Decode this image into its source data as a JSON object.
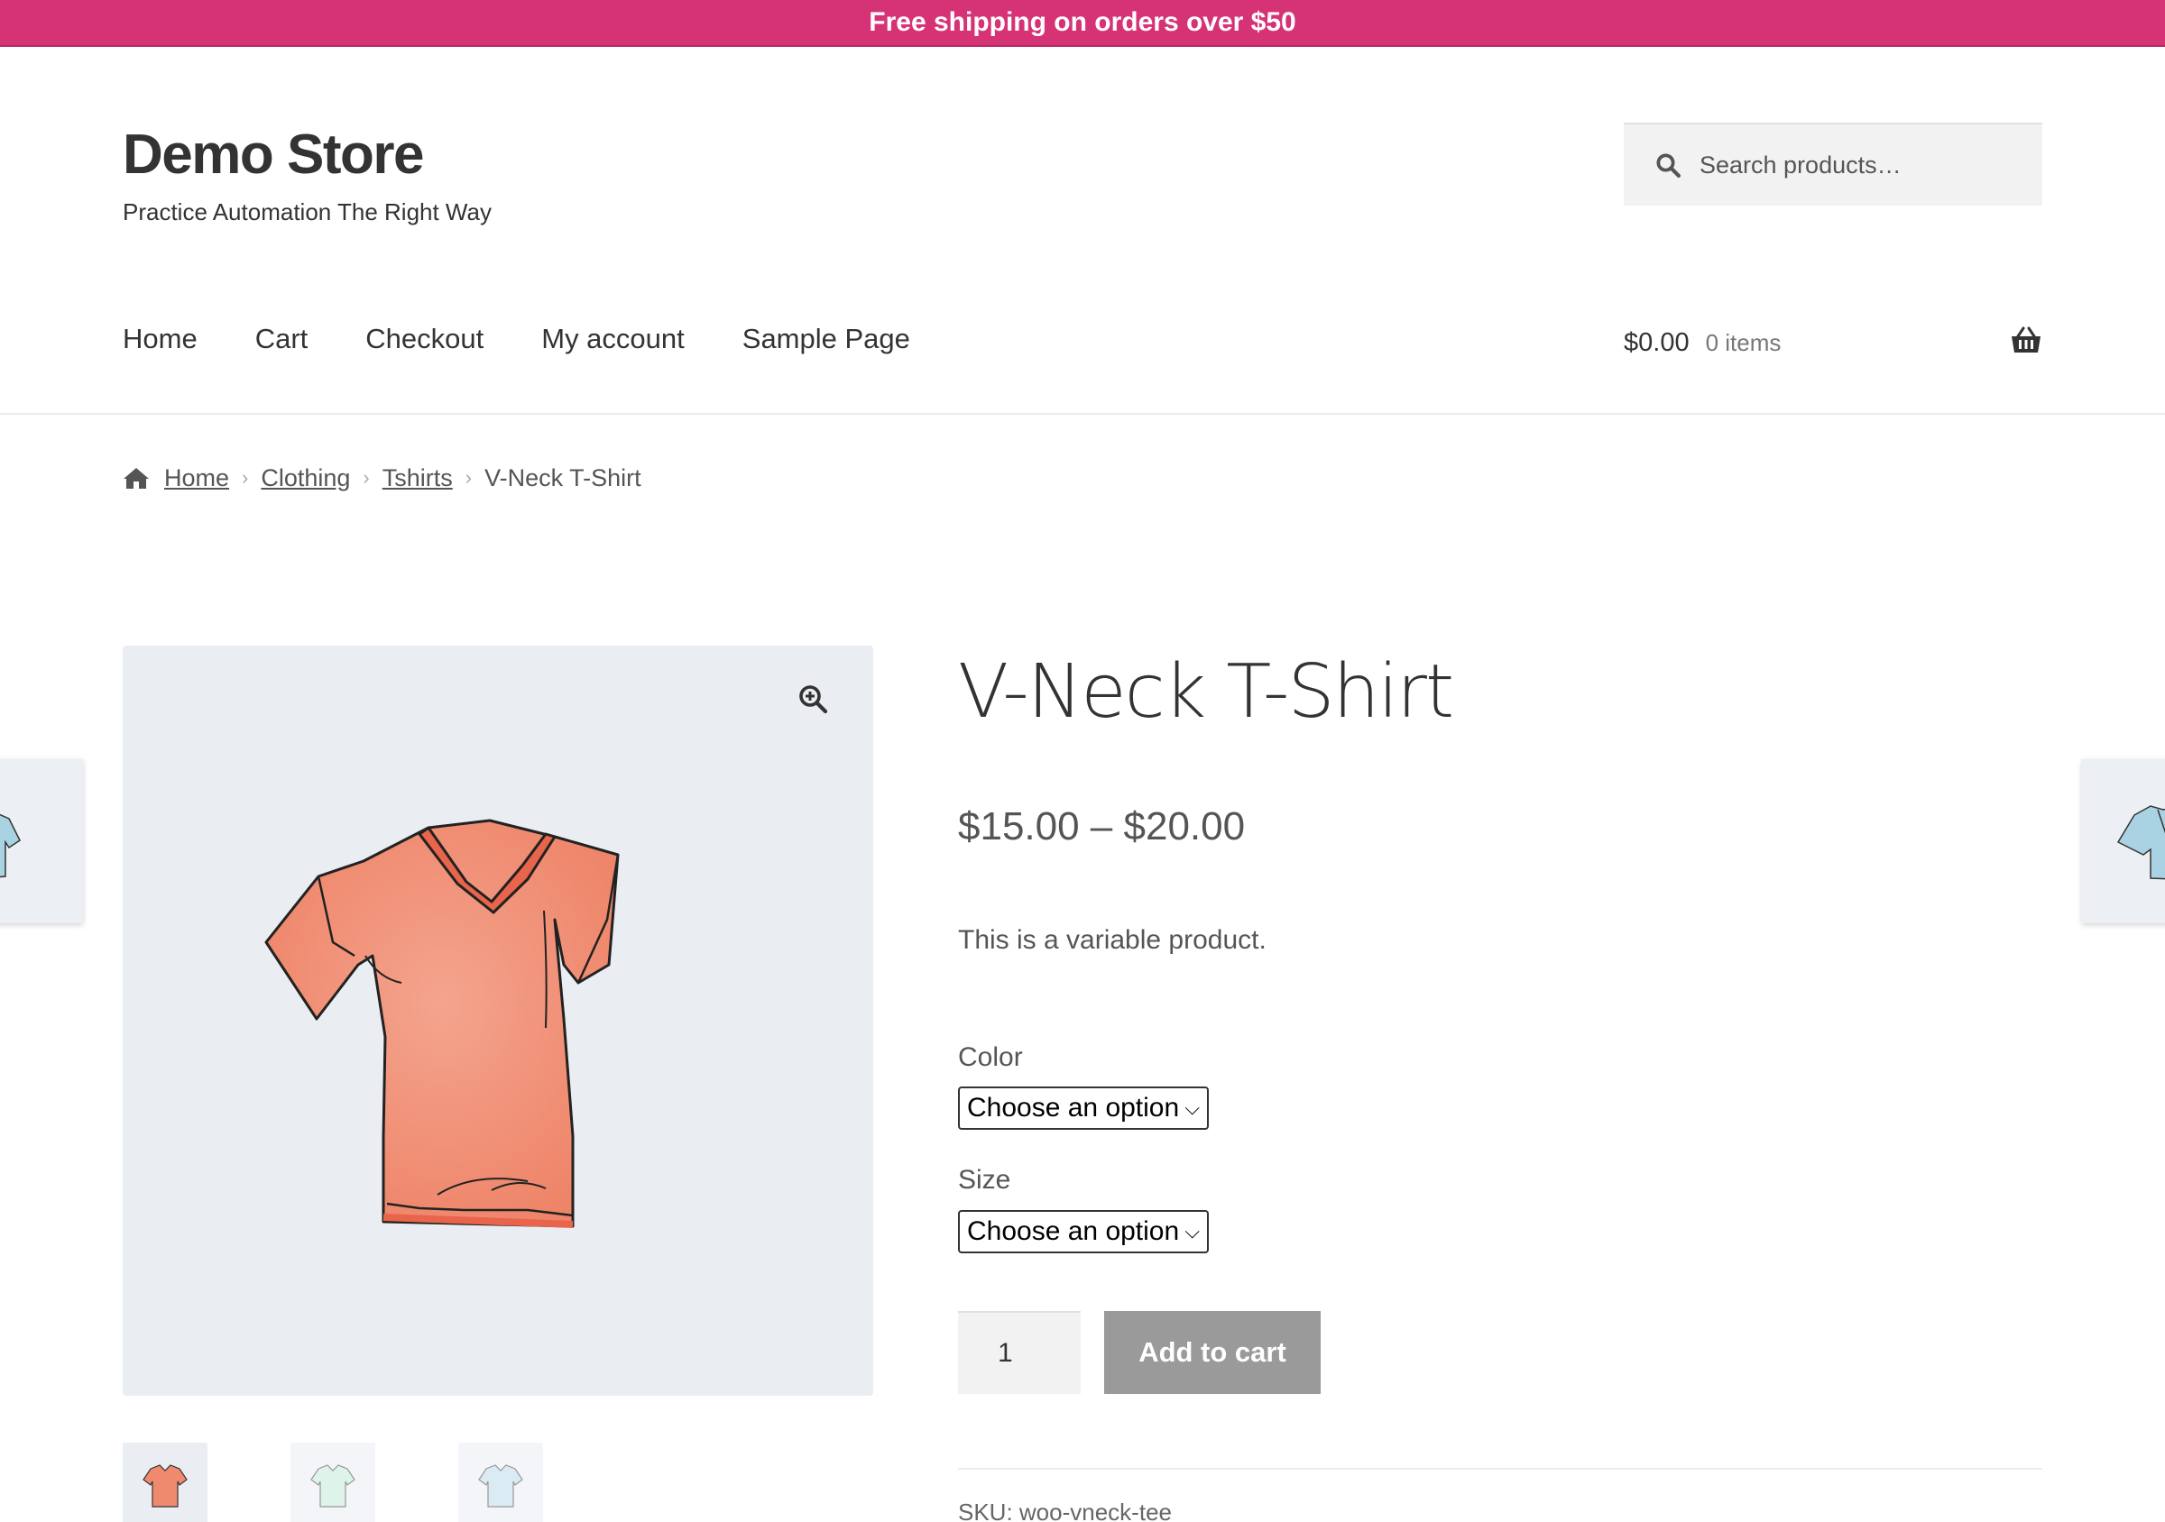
{
  "promo": {
    "text": "Free shipping on orders over $50"
  },
  "header": {
    "site_title": "Demo Store",
    "tagline": "Practice Automation The Right Way",
    "search_placeholder": "Search products…"
  },
  "nav": {
    "items": [
      {
        "label": "Home"
      },
      {
        "label": "Cart"
      },
      {
        "label": "Checkout"
      },
      {
        "label": "My account"
      },
      {
        "label": "Sample Page"
      }
    ]
  },
  "cart": {
    "amount": "$0.00",
    "count": "0 items"
  },
  "breadcrumb": {
    "home": "Home",
    "clothing": "Clothing",
    "tshirts": "Tshirts",
    "current": "V-Neck T-Shirt",
    "separator": "›"
  },
  "product": {
    "title": "V-Neck T-Shirt",
    "price": "$15.00 – $20.00",
    "short_description": "This is a variable product.",
    "color_label": "Color",
    "color_value": "Choose an option",
    "size_label": "Size",
    "size_value": "Choose an option",
    "quantity": "1",
    "add_to_cart": "Add to cart",
    "sku": "SKU: woo-vneck-tee"
  },
  "gallery": {
    "thumbnails": [
      {
        "color": "#f08a6e",
        "label": "red v-neck"
      },
      {
        "color": "#bfe8d6",
        "label": "green v-neck"
      },
      {
        "color": "#b9d8ea",
        "label": "blue v-neck"
      }
    ]
  },
  "colors": {
    "brand": "#d63376",
    "button_disabled": "#9a9a9a",
    "image_bg": "#eaedf2"
  }
}
